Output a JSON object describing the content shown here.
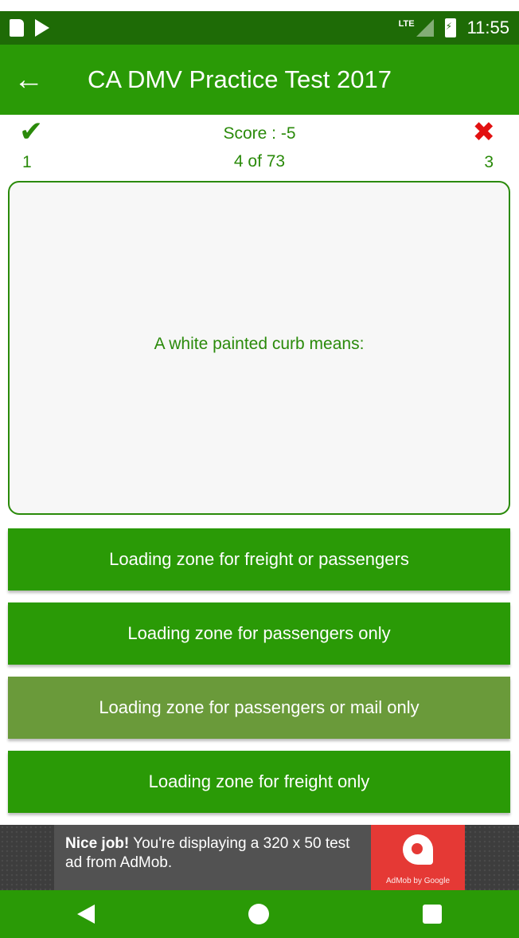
{
  "status_bar": {
    "network_label": "LTE",
    "time": "11:55",
    "icons": [
      "sd-card-icon",
      "play-store-icon",
      "signal-icon",
      "battery-charging-icon"
    ]
  },
  "app_bar": {
    "title": "CA DMV Practice Test 2017",
    "back_icon": "arrow-left-icon"
  },
  "score_bar": {
    "correct_count": "1",
    "wrong_count": "3",
    "score_text": "Score : -5",
    "progress_text": "4 of 73"
  },
  "question": {
    "text": "A white painted curb means:"
  },
  "answers": [
    {
      "label": "Loading zone for freight or passengers",
      "color": "#2a9a06"
    },
    {
      "label": "Loading zone for passengers only",
      "color": "#2a9a06"
    },
    {
      "label": "Loading zone for passengers or mail only",
      "color": "#6a9a3a"
    },
    {
      "label": "Loading zone for freight only",
      "color": "#2a9a06"
    }
  ],
  "ad": {
    "bold_text": "Nice job!",
    "body_text": "You're displaying a 320 x 50 test ad from AdMob.",
    "logo_text": "AdMob by Google"
  },
  "colors": {
    "app_green": "#2a9a06",
    "status_green": "#1e6b06",
    "text_green": "#2a8a0a",
    "wrong_red": "#e21111",
    "selected_answer": "#6a9a3a"
  }
}
